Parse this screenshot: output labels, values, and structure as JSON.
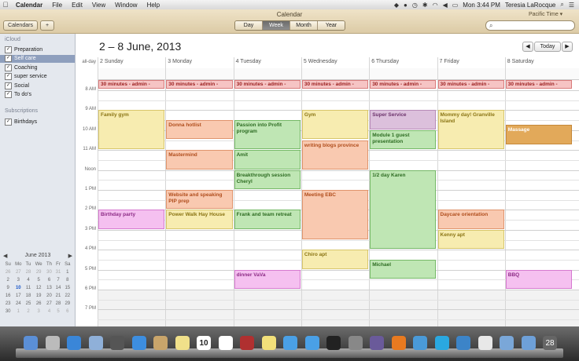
{
  "menubar": {
    "app": "Calendar",
    "menus": [
      "File",
      "Edit",
      "View",
      "Window",
      "Help"
    ],
    "clock": "Mon 3:44 PM",
    "user": "Teresia LaRocque"
  },
  "toolbar": {
    "window_title": "Calendar",
    "calendars_btn": "Calendars",
    "add_btn": "+",
    "views": [
      "Day",
      "Week",
      "Month",
      "Year"
    ],
    "active_view": "Week",
    "timezone": "Pacific Time ▾",
    "search_placeholder": ""
  },
  "sidebar": {
    "icloud_header": "iCloud",
    "icloud_items": [
      {
        "label": "Preparation",
        "checked": true
      },
      {
        "label": "Self care",
        "checked": true,
        "selected": true
      },
      {
        "label": "Coaching",
        "checked": true
      },
      {
        "label": "super service",
        "checked": true
      },
      {
        "label": "Social",
        "checked": true
      },
      {
        "label": "To do's",
        "checked": true
      }
    ],
    "subs_header": "Subscriptions",
    "subs_items": [
      {
        "label": "Birthdays",
        "checked": true
      }
    ],
    "mini_month": "June 2013",
    "mini_days": [
      "Su",
      "Mo",
      "Tu",
      "We",
      "Th",
      "Fr",
      "Sa"
    ],
    "mini_weeks": [
      [
        "26",
        "27",
        "28",
        "29",
        "30",
        "31",
        "1"
      ],
      [
        "2",
        "3",
        "4",
        "5",
        "6",
        "7",
        "8"
      ],
      [
        "9",
        "10",
        "11",
        "12",
        "13",
        "14",
        "15"
      ],
      [
        "16",
        "17",
        "18",
        "19",
        "20",
        "21",
        "22"
      ],
      [
        "23",
        "24",
        "25",
        "26",
        "27",
        "28",
        "29"
      ],
      [
        "30",
        "1",
        "2",
        "3",
        "4",
        "5",
        "6"
      ]
    ]
  },
  "main": {
    "range_title": "2 – 8 June, 2013",
    "today_btn": "Today",
    "prev": "◀",
    "next": "▶",
    "allday_label": "all-day",
    "days": [
      "2 Sunday",
      "3 Monday",
      "4 Tuesday",
      "5 Wednesday",
      "6 Thursday",
      "7 Friday",
      "8 Saturday"
    ],
    "times": [
      "8 AM",
      "9 AM",
      "10 AM",
      "11 AM",
      "Noon",
      "1 PM",
      "2 PM",
      "3 PM",
      "4 PM",
      "5 PM",
      "6 PM",
      "7 PM"
    ],
    "allday_event": "30 minutes - admin - see...",
    "events": [
      {
        "day": 0,
        "start": 9.0,
        "end": 11.0,
        "title": "Family gym",
        "cal": "yellow"
      },
      {
        "day": 0,
        "start": 2.0,
        "end": 3.0,
        "title": "Birthday party",
        "cal": "pink",
        "pm": true
      },
      {
        "day": 1,
        "start": 9.5,
        "end": 10.5,
        "title": "Donna hotlist",
        "cal": "orange"
      },
      {
        "day": 1,
        "start": 11.0,
        "end": 12.0,
        "title": "Mastermind",
        "cal": "orange"
      },
      {
        "day": 1,
        "start": 13.0,
        "end": 14.0,
        "title": "Website and speaking PIP prep",
        "cal": "orange"
      },
      {
        "day": 1,
        "start": 14.0,
        "end": 15.0,
        "title": "Power Walk  Hay House",
        "cal": "yellow"
      },
      {
        "day": 2,
        "start": 9.5,
        "end": 11.0,
        "title": "Passion into Profit program",
        "cal": "green"
      },
      {
        "day": 2,
        "start": 11.0,
        "end": 12.0,
        "title": "Amit",
        "cal": "green"
      },
      {
        "day": 2,
        "start": 12.0,
        "end": 13.0,
        "title": "Breakthrough session Cheryl",
        "cal": "green"
      },
      {
        "day": 2,
        "start": 14.0,
        "end": 15.0,
        "title": "Frank and team retreat",
        "cal": "green"
      },
      {
        "day": 2,
        "start": 17.0,
        "end": 18.0,
        "title": "dinner VaVa",
        "cal": "pink"
      },
      {
        "day": 3,
        "start": 9.0,
        "end": 10.5,
        "title": "Gym",
        "cal": "yellow"
      },
      {
        "day": 3,
        "start": 10.5,
        "end": 12.0,
        "title": "writing blogs province",
        "cal": "orange"
      },
      {
        "day": 3,
        "start": 13.0,
        "end": 15.5,
        "title": "Meeting EBC",
        "cal": "orange"
      },
      {
        "day": 3,
        "start": 16.0,
        "end": 17.0,
        "title": "Chiro apt",
        "cal": "yellow"
      },
      {
        "day": 4,
        "start": 9.0,
        "end": 10.0,
        "title": "Super Service",
        "cal": "purple"
      },
      {
        "day": 4,
        "start": 10.0,
        "end": 11.0,
        "title": "Module 1 guest presentation",
        "cal": "green"
      },
      {
        "day": 4,
        "start": 12.0,
        "end": 16.0,
        "title": "1/2 day Karen",
        "cal": "green"
      },
      {
        "day": 4,
        "start": 16.5,
        "end": 17.5,
        "title": "Michael",
        "cal": "green"
      },
      {
        "day": 5,
        "start": 9.0,
        "end": 11.0,
        "title": "Mommy day! Granville Island",
        "cal": "yellow"
      },
      {
        "day": 5,
        "start": 14.0,
        "end": 15.0,
        "title": "Daycare orientation",
        "cal": "orange"
      },
      {
        "day": 5,
        "start": 15.0,
        "end": 16.0,
        "title": "Kenny apt",
        "cal": "yellow"
      },
      {
        "day": 6,
        "start": 9.75,
        "end": 10.75,
        "title": "Massage",
        "cal": "amber"
      },
      {
        "day": 6,
        "start": 17.0,
        "end": 18.0,
        "title": "BBQ",
        "cal": "pink"
      }
    ]
  },
  "colors": {
    "yellow": {
      "bg": "#f7ecb0",
      "border": "#d8c66a",
      "text": "#8a7413"
    },
    "orange": {
      "bg": "#f9c9b0",
      "border": "#e0946c",
      "text": "#b04d1c"
    },
    "green": {
      "bg": "#bfe6b4",
      "border": "#76b967",
      "text": "#2d6c22"
    },
    "pink": {
      "bg": "#f5c0f0",
      "border": "#d67ad0",
      "text": "#8d2b86"
    },
    "purple": {
      "bg": "#dcc0dc",
      "border": "#b78ab7",
      "text": "#6b326b"
    },
    "amber": {
      "bg": "#e2a95a",
      "border": "#c5883a",
      "text": "#ffffff"
    },
    "red": {
      "bg": "#f6c4c4",
      "border": "#d97b7b",
      "text": "#9c2020"
    }
  },
  "dock": {
    "calendar_day": "10",
    "trash_count": "28",
    "icons": [
      "finder-icon",
      "launchpad-icon",
      "appstore-icon",
      "mail-icon",
      "facetime-icon",
      "safari-icon",
      "contacts-icon",
      "notes-icon",
      "calendar-icon",
      "reminders-icon",
      "photobooth-icon",
      "stickies-icon",
      "itunes-icon",
      "itunes2-icon",
      "dvd-icon",
      "preview-icon",
      "pencil-icon",
      "firefox-icon",
      "dropbox-icon",
      "skype-icon",
      "globe-icon",
      "docs-icon",
      "folder-icon",
      "downloads-icon",
      "trash-icon"
    ]
  }
}
